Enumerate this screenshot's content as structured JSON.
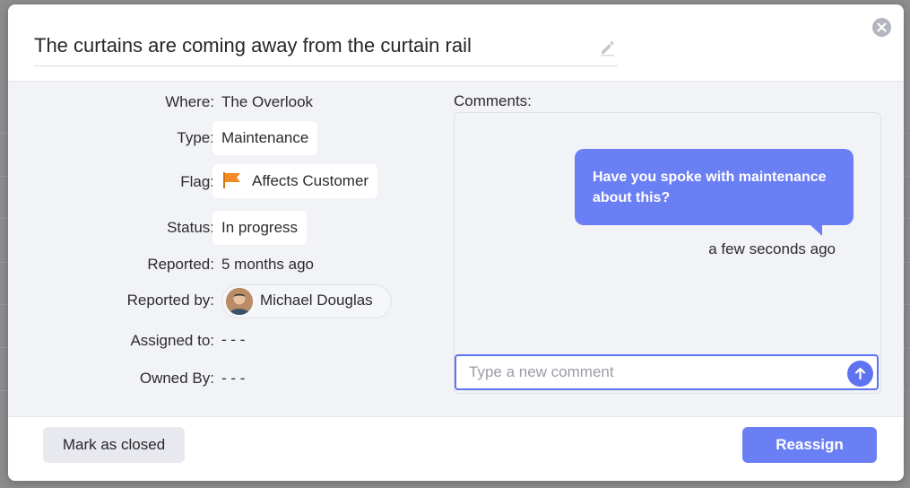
{
  "issue": {
    "title": "The curtains are coming away from the curtain rail"
  },
  "details": {
    "where_label": "Where:",
    "where_value": "The Overlook",
    "type_label": "Type:",
    "type_value": "Maintenance",
    "flag_label": "Flag:",
    "flag_value": "Affects Customer",
    "status_label": "Status:",
    "status_value": "In progress",
    "reported_label": "Reported:",
    "reported_value": "5 months ago",
    "reported_by_label": "Reported by:",
    "reported_by_value": "Michael Douglas",
    "assigned_to_label": "Assigned to:",
    "assigned_to_value": "- - -",
    "owned_by_label": "Owned By:",
    "owned_by_value": "- - -"
  },
  "comments": {
    "label": "Comments:",
    "items": [
      {
        "text": "Have you spoke with maintenance about this?",
        "time": "a few seconds ago"
      }
    ],
    "input_placeholder": "Type a new comment"
  },
  "footer": {
    "mark_closed_label": "Mark as closed",
    "reassign_label": "Reassign"
  },
  "colors": {
    "accent": "#6b7ff5",
    "flag": "#f28a24",
    "panel_bg": "#f2f3f7"
  },
  "icons": {
    "edit": "pencil-icon",
    "close": "close-circle-icon",
    "flag": "flag-icon",
    "send": "arrow-up-icon"
  }
}
